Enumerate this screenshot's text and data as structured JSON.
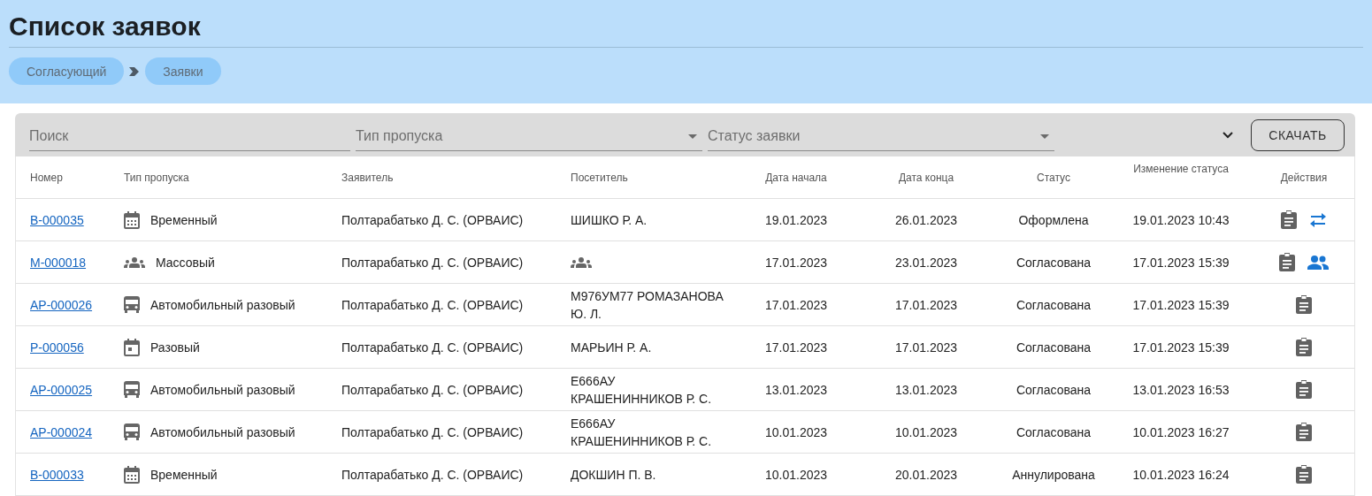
{
  "page_title": "Список заявок",
  "breadcrumbs": [
    {
      "label": "Согласующий"
    },
    {
      "label": "Заявки"
    }
  ],
  "filters": {
    "search": {
      "placeholder": "Поиск"
    },
    "pass_type": {
      "placeholder": "Тип пропуска"
    },
    "status": {
      "placeholder": "Статус заявки"
    },
    "download_button": "СКАЧАТЬ"
  },
  "table": {
    "columns": [
      "Номер",
      "Тип пропуска",
      "Заявитель",
      "Посетитель",
      "Дата начала",
      "Дата конца",
      "Статус",
      "Изменение статуса",
      "Действия"
    ],
    "rows": [
      {
        "number": "В-000035",
        "type": {
          "kind": "calendar",
          "label": "Временный"
        },
        "applicant": "Полтарабатько Д. С. (ОРВАИС)",
        "visitor": {
          "kind": "text",
          "lines": [
            "ШИШКО Р. А."
          ]
        },
        "start": "19.01.2023",
        "end": "26.01.2023",
        "status": "Оформлена",
        "changed": "19.01.2023 10:43",
        "actions": [
          {
            "kind": "clipboard"
          },
          {
            "kind": "swap"
          }
        ]
      },
      {
        "number": "М-000018",
        "type": {
          "kind": "group",
          "label": "Массовый"
        },
        "applicant": "Полтарабатько Д. С. (ОРВАИС)",
        "visitor": {
          "kind": "group"
        },
        "start": "17.01.2023",
        "end": "23.01.2023",
        "status": "Согласована",
        "changed": "17.01.2023 15:39",
        "actions": [
          {
            "kind": "clipboard"
          },
          {
            "kind": "group"
          }
        ]
      },
      {
        "number": "АР-000026",
        "type": {
          "kind": "bus",
          "label": "Автомобильный разовый"
        },
        "applicant": "Полтарабатько Д. С. (ОРВАИС)",
        "visitor": {
          "kind": "text",
          "lines": [
            "М976УМ77 РОМАЗАНОВА",
            "Ю. Л."
          ]
        },
        "start": "17.01.2023",
        "end": "17.01.2023",
        "status": "Согласована",
        "changed": "17.01.2023 15:39",
        "actions": [
          {
            "kind": "clipboard"
          }
        ]
      },
      {
        "number": "Р-000056",
        "type": {
          "kind": "day",
          "label": "Разовый"
        },
        "applicant": "Полтарабатько Д. С. (ОРВАИС)",
        "visitor": {
          "kind": "text",
          "lines": [
            "МАРЬИН Р. А."
          ]
        },
        "start": "17.01.2023",
        "end": "17.01.2023",
        "status": "Согласована",
        "changed": "17.01.2023 15:39",
        "actions": [
          {
            "kind": "clipboard"
          }
        ]
      },
      {
        "number": "АР-000025",
        "type": {
          "kind": "bus",
          "label": "Автомобильный разовый"
        },
        "applicant": "Полтарабатько Д. С. (ОРВАИС)",
        "visitor": {
          "kind": "text",
          "lines": [
            "Е666АУ",
            "КРАШЕНИННИКОВ Р. С."
          ]
        },
        "start": "13.01.2023",
        "end": "13.01.2023",
        "status": "Согласована",
        "changed": "13.01.2023 16:53",
        "actions": [
          {
            "kind": "clipboard"
          }
        ]
      },
      {
        "number": "АР-000024",
        "type": {
          "kind": "bus",
          "label": "Автомобильный разовый"
        },
        "applicant": "Полтарабатько Д. С. (ОРВАИС)",
        "visitor": {
          "kind": "text",
          "lines": [
            "Е666АУ",
            "КРАШЕНИННИКОВ Р. С."
          ]
        },
        "start": "10.01.2023",
        "end": "10.01.2023",
        "status": "Согласована",
        "changed": "10.01.2023 16:27",
        "actions": [
          {
            "kind": "clipboard"
          }
        ]
      },
      {
        "number": "В-000033",
        "type": {
          "kind": "calendar",
          "label": "Временный"
        },
        "applicant": "Полтарабатько Д. С. (ОРВАИС)",
        "visitor": {
          "kind": "text",
          "lines": [
            "ДОКШИН П. В."
          ]
        },
        "start": "10.01.2023",
        "end": "20.01.2023",
        "status": "Аннулирована",
        "changed": "10.01.2023 16:24",
        "actions": [
          {
            "kind": "clipboard"
          }
        ]
      }
    ]
  }
}
